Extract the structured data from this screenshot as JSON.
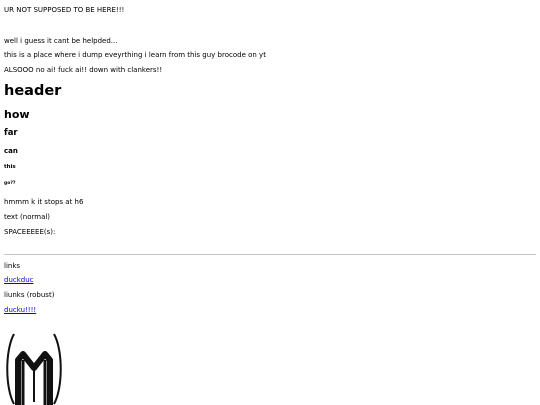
{
  "content": {
    "intro": "UR NOT SUPPOSED TO BE HERE!!!",
    "well": "well i guess it cant be helpded...",
    "dump": "this is a place where i dump eveyrthing i learn from this guy brocode on yt",
    "also": "ALSOOO no ai! fuck ai!! down with clankers!!",
    "h1": "header",
    "h2": "how",
    "h3": "far",
    "h4": "can",
    "h5": "this",
    "h6": "go??",
    "hmm": "hmmm k it stops at h6",
    "text_normal": "text (normal)",
    "spaces": "SPACEEEEE(s):",
    "links_label": "links",
    "link1": "duckduc",
    "liunks_label": "liunks (robust)",
    "link2": "ducku!!!!"
  },
  "colors": {
    "link": "#0000ee",
    "text": "#000000",
    "rule": "#c4c4c4"
  },
  "icons": {
    "logo": "stylized-m-emblem"
  }
}
